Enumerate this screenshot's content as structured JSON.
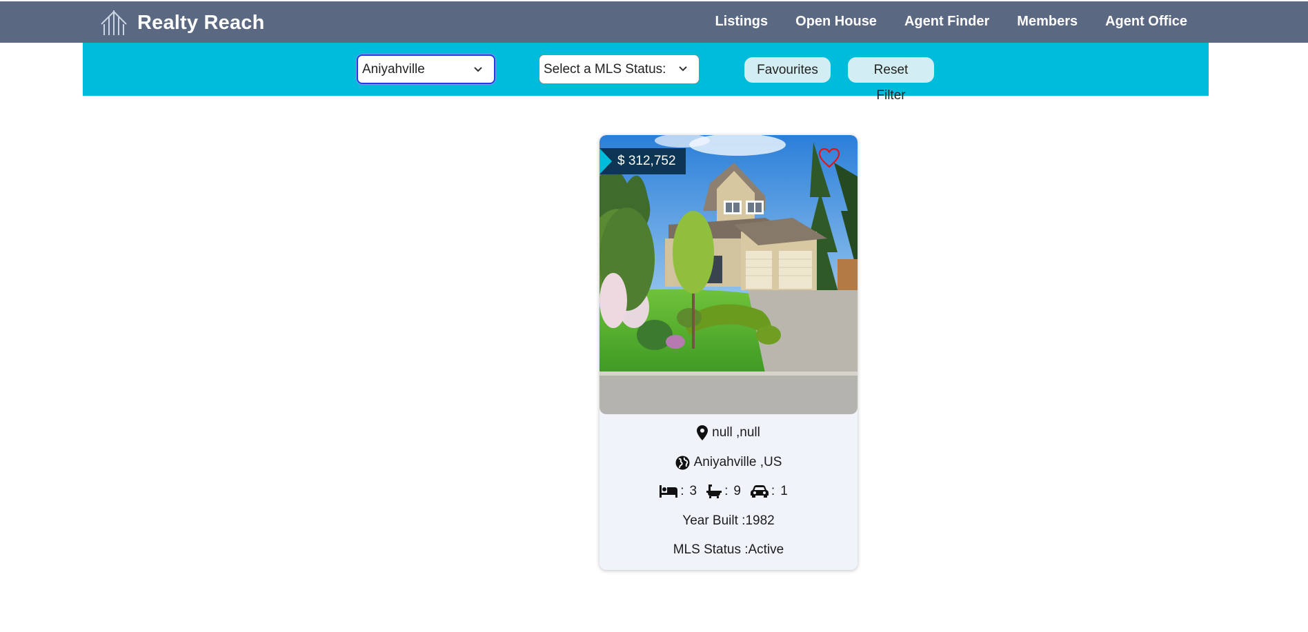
{
  "header": {
    "brand": "Realty Reach",
    "logo_icon": "building-icon",
    "nav": [
      {
        "label": "Listings"
      },
      {
        "label": "Open House"
      },
      {
        "label": "Agent Finder"
      },
      {
        "label": "Members"
      },
      {
        "label": "Agent Office"
      }
    ],
    "background_color": "#5b6881"
  },
  "filters": {
    "city_select": {
      "value": "Aniyahville"
    },
    "status_select": {
      "value": "Select a MLS Status:"
    },
    "favourites_label": "Favourites",
    "reset_label": "Reset Filter",
    "bar_color": "#00bcdb"
  },
  "listing": {
    "price": "$ 312,752",
    "favourite_icon": "heart-outline-icon",
    "address": "null ,null",
    "city_country": "Aniyahville ,US",
    "bedrooms": "3",
    "bathrooms": "9",
    "parking": "1",
    "separator": ":",
    "year_built": "Year Built :1982",
    "mls_status": "MLS Status :Active"
  }
}
